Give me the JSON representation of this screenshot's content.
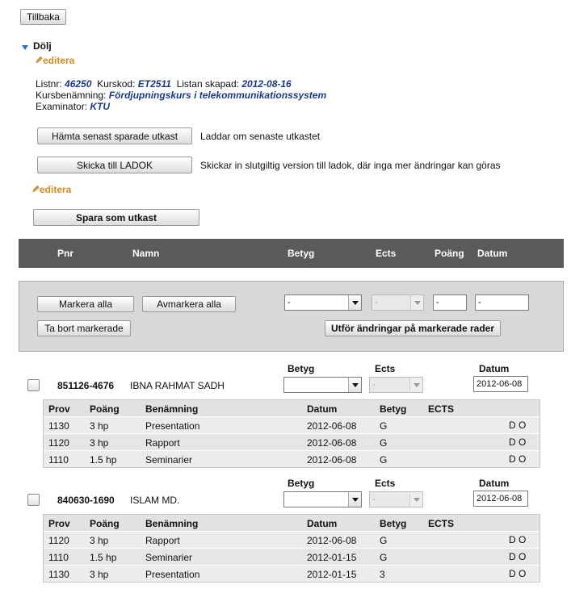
{
  "toolbar": {
    "back_label": "Tillbaka"
  },
  "toggle": {
    "label": "Dölj"
  },
  "edit_link_label": "editera",
  "info": {
    "listnr_label": "Listnr:",
    "listnr": "46250",
    "kurskod_label": "Kurskod:",
    "kurskod": "ET2511",
    "skapad_label": "Listan skapad:",
    "skapad": "2012-08-16",
    "kursbenamning_label": "Kursbenämning:",
    "kursbenamning": "Fördjupningskurs i telekommunikationssystem",
    "examinator_label": "Examinator:",
    "examinator": "KTU"
  },
  "actions": {
    "fetch_label": "Hämta senast sparade utkast",
    "fetch_desc": "Laddar om senaste utkastet",
    "send_label": "Skicka till LADOK",
    "send_desc": "Skickar in slutgiltig version till ladok, där inga mer ändringar kan göras",
    "save_draft_label": "Spara som utkast"
  },
  "table_header": {
    "pnr": "Pnr",
    "namn": "Namn",
    "betyg": "Betyg",
    "ects": "Ects",
    "poang": "Poäng",
    "datum": "Datum"
  },
  "bulk": {
    "mark_all": "Markera alla",
    "unmark_all": "Avmarkera alla",
    "remove_marked": "Ta bort markerade",
    "apply_marked": "Utför ändringar på markerade rader",
    "betyg_value": "-",
    "ects_value": "-",
    "poang_value": "-",
    "datum_value": "-"
  },
  "student_labels": {
    "betyg": "Betyg",
    "ects": "Ects",
    "datum": "Datum"
  },
  "sub_header": {
    "prov": "Prov",
    "poang": "Poäng",
    "benamning": "Benämning",
    "datum": "Datum",
    "betyg": "Betyg",
    "ects": "ECTS"
  },
  "students": [
    {
      "pnr": "851126-4676",
      "namn": "IBNA RAHMAT SADH",
      "betyg": "",
      "ects": "-",
      "datum": "2012-06-08",
      "rows": [
        {
          "prov": "1130",
          "poang": "3 hp",
          "benamning": "Presentation",
          "datum": "2012-06-08",
          "betyg": "G",
          "ects": "",
          "flags": "D O"
        },
        {
          "prov": "1120",
          "poang": "3 hp",
          "benamning": "Rapport",
          "datum": "2012-06-08",
          "betyg": "G",
          "ects": "",
          "flags": "D O"
        },
        {
          "prov": "1110",
          "poang": "1.5 hp",
          "benamning": "Seminarier",
          "datum": "2012-06-08",
          "betyg": "G",
          "ects": "",
          "flags": "D O"
        }
      ]
    },
    {
      "pnr": "840630-1690",
      "namn": "ISLAM MD.",
      "betyg": "",
      "ects": "-",
      "datum": "2012-06-08",
      "rows": [
        {
          "prov": "1120",
          "poang": "3 hp",
          "benamning": "Rapport",
          "datum": "2012-06-08",
          "betyg": "G",
          "ects": "",
          "flags": "D O"
        },
        {
          "prov": "1110",
          "poang": "1.5 hp",
          "benamning": "Seminarier",
          "datum": "2012-01-15",
          "betyg": "G",
          "ects": "",
          "flags": "D O"
        },
        {
          "prov": "1130",
          "poang": "3 hp",
          "benamning": "Presentation",
          "datum": "2012-01-15",
          "betyg": "3",
          "ects": "",
          "flags": "D O"
        }
      ]
    }
  ],
  "colors": {
    "header_bg": "#5a5a5a",
    "link": "#d88a1a",
    "value_blue": "#1b3a8a",
    "toggle_arrow": "#2a6ed6"
  }
}
